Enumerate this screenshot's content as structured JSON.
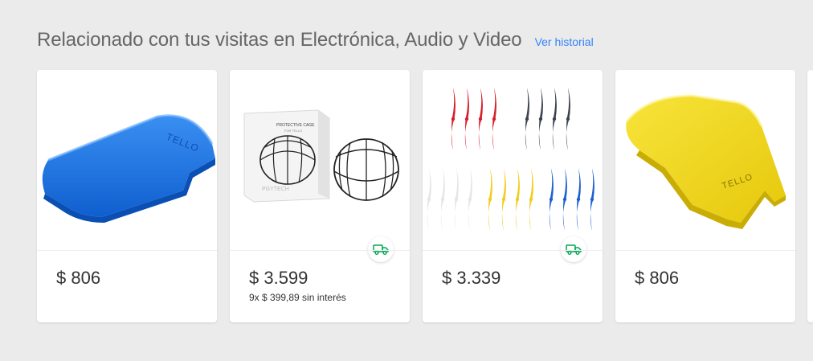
{
  "section": {
    "title": "Relacionado con tus visitas en Electrónica, Audio y Video",
    "history_link": "Ver historial"
  },
  "products": [
    {
      "image_icon": "blue-drone-cover-image",
      "price": "$ 806",
      "installments": "",
      "free_shipping": false
    },
    {
      "image_icon": "protective-cage-image",
      "image_box_label": "PROTECTIVE CAGE",
      "image_box_sublabel": "FOR TELLO",
      "image_box_brand": "PGYTECH",
      "price": "$ 3.599",
      "installments": "9x $ 399,89 sin interés",
      "free_shipping": true
    },
    {
      "image_icon": "propellers-set-image",
      "price": "$ 3.339",
      "installments": "",
      "free_shipping": true
    },
    {
      "image_icon": "yellow-drone-cover-image",
      "image_brand": "TELLO",
      "price": "$ 806",
      "installments": "",
      "free_shipping": false
    }
  ],
  "colors": {
    "link": "#3483fa",
    "shipping_green": "#00a650",
    "blue_cover": "#1e77e6",
    "yellow_cover": "#f2d81b"
  }
}
